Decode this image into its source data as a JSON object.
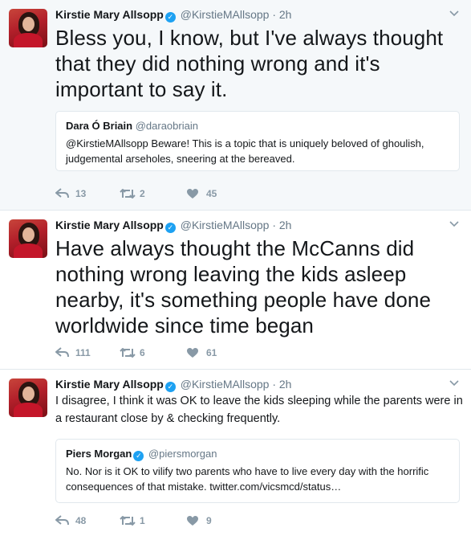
{
  "tweets": [
    {
      "author_name": "Kirstie Mary Allsopp",
      "author_handle": "@KirstieMAllsopp",
      "separator": "·",
      "time": "2h",
      "text": "Bless you, I know, but I've always thought that they did nothing wrong and it's important to say it.",
      "quote": {
        "author_name": "Dara Ó Briain",
        "author_handle": "@daraobriain",
        "text": "@KirstieMAllsopp Beware! This is a topic that is uniquely beloved of ghoulish, judgemental arseholes, sneering at the bereaved."
      },
      "replies": "13",
      "retweets": "2",
      "likes": "45"
    },
    {
      "author_name": "Kirstie Mary Allsopp",
      "author_handle": "@KirstieMAllsopp",
      "separator": "·",
      "time": "2h",
      "text": "Have always thought the McCanns did nothing wrong leaving the kids asleep nearby, it's something people have done worldwide since time began",
      "replies": "111",
      "retweets": "6",
      "likes": "61"
    },
    {
      "author_name": "Kirstie Mary Allsopp",
      "author_handle": "@KirstieMAllsopp",
      "separator": "·",
      "time": "2h",
      "text": "I disagree, I think it was OK to leave the kids sleeping while the parents were in a restaurant close by & checking frequently.",
      "quote": {
        "author_name": "Piers Morgan",
        "author_handle": "@piersmorgan",
        "text": "No. Nor is it OK to vilify two parents who have to live every day with the horrific consequences of that mistake. twitter.com/vicsmcd/status…"
      },
      "replies": "48",
      "retweets": "1",
      "likes": "9"
    }
  ],
  "icons": {
    "verified": "verified-badge-icon",
    "reply": "reply-icon",
    "retweet": "retweet-icon",
    "like": "heart-icon",
    "more": "chevron-down-icon"
  },
  "colors": {
    "verified_blue": "#1da1f2",
    "meta_gray": "#657786",
    "action_gray": "#8899a6",
    "highlight_bg": "#f5f8fa"
  }
}
